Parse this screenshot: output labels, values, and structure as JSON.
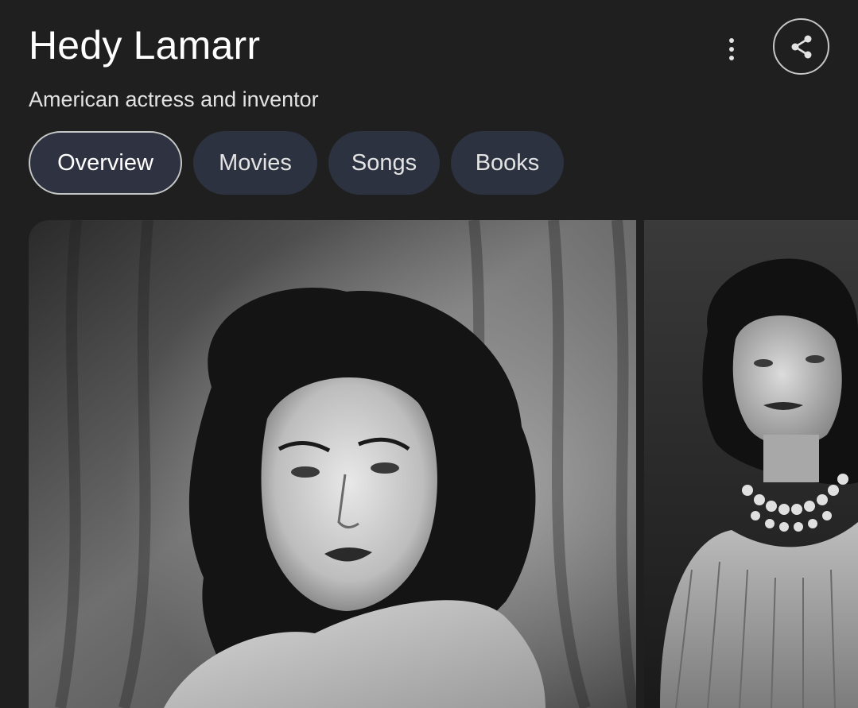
{
  "entity": {
    "name": "Hedy Lamarr",
    "description": "American actress and inventor"
  },
  "actions": {
    "more_icon": "more-vert-icon",
    "share_icon": "share-icon"
  },
  "tabs": [
    {
      "label": "Overview",
      "active": true
    },
    {
      "label": "Movies",
      "active": false
    },
    {
      "label": "Songs",
      "active": false
    },
    {
      "label": "Books",
      "active": false
    }
  ],
  "images": [
    {
      "kind": "black-and-white portrait photo"
    },
    {
      "kind": "black-and-white portrait photo with pearl necklace"
    }
  ],
  "colors": {
    "background": "#1f1f1f",
    "chip": "#2d3240",
    "chip_border": "#c4c7c5",
    "text": "#e3e3e3"
  }
}
